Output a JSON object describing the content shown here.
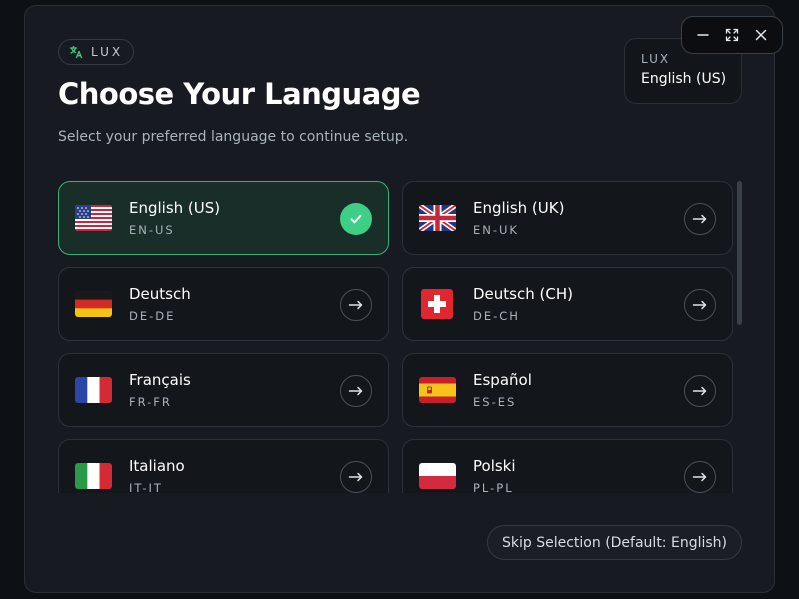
{
  "brand": {
    "name": "LUX",
    "icon": "translate-icon"
  },
  "header": {
    "title": "Choose Your Language",
    "subtitle": "Select your preferred language to continue setup."
  },
  "current": {
    "label": "LUX",
    "value": "English (US)"
  },
  "window_controls": {
    "icons": [
      "minimize-icon",
      "expand-icon",
      "close-icon"
    ]
  },
  "colors": {
    "accent": "#3ccf85",
    "selected_bg": "#1a2e29",
    "panel_bg": "#171b21"
  },
  "languages": [
    {
      "name": "English (US)",
      "code": "EN-US",
      "flag": "flag-us-icon",
      "selected": true
    },
    {
      "name": "English (UK)",
      "code": "EN-UK",
      "flag": "flag-uk-icon",
      "selected": false
    },
    {
      "name": "Deutsch",
      "code": "DE-DE",
      "flag": "flag-de-icon",
      "selected": false
    },
    {
      "name": "Deutsch (CH)",
      "code": "DE-CH",
      "flag": "flag-ch-icon",
      "selected": false
    },
    {
      "name": "Français",
      "code": "FR-FR",
      "flag": "flag-fr-icon",
      "selected": false
    },
    {
      "name": "Español",
      "code": "ES-ES",
      "flag": "flag-es-icon",
      "selected": false
    },
    {
      "name": "Italiano",
      "code": "IT-IT",
      "flag": "flag-it-icon",
      "selected": false
    },
    {
      "name": "Polski",
      "code": "PL-PL",
      "flag": "flag-pl-icon",
      "selected": false
    }
  ],
  "footer": {
    "skip_label": "Skip Selection (Default: English)"
  }
}
